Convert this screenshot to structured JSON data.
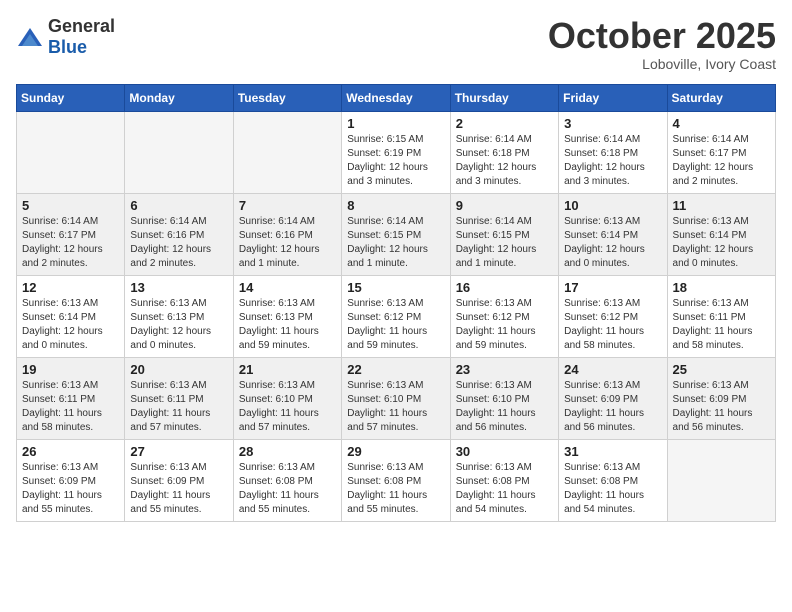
{
  "logo": {
    "general": "General",
    "blue": "Blue"
  },
  "header": {
    "month": "October 2025",
    "location": "Loboville, Ivory Coast"
  },
  "weekdays": [
    "Sunday",
    "Monday",
    "Tuesday",
    "Wednesday",
    "Thursday",
    "Friday",
    "Saturday"
  ],
  "weeks": [
    [
      {
        "day": "",
        "info": ""
      },
      {
        "day": "",
        "info": ""
      },
      {
        "day": "",
        "info": ""
      },
      {
        "day": "1",
        "info": "Sunrise: 6:15 AM\nSunset: 6:19 PM\nDaylight: 12 hours\nand 3 minutes."
      },
      {
        "day": "2",
        "info": "Sunrise: 6:14 AM\nSunset: 6:18 PM\nDaylight: 12 hours\nand 3 minutes."
      },
      {
        "day": "3",
        "info": "Sunrise: 6:14 AM\nSunset: 6:18 PM\nDaylight: 12 hours\nand 3 minutes."
      },
      {
        "day": "4",
        "info": "Sunrise: 6:14 AM\nSunset: 6:17 PM\nDaylight: 12 hours\nand 2 minutes."
      }
    ],
    [
      {
        "day": "5",
        "info": "Sunrise: 6:14 AM\nSunset: 6:17 PM\nDaylight: 12 hours\nand 2 minutes."
      },
      {
        "day": "6",
        "info": "Sunrise: 6:14 AM\nSunset: 6:16 PM\nDaylight: 12 hours\nand 2 minutes."
      },
      {
        "day": "7",
        "info": "Sunrise: 6:14 AM\nSunset: 6:16 PM\nDaylight: 12 hours\nand 1 minute."
      },
      {
        "day": "8",
        "info": "Sunrise: 6:14 AM\nSunset: 6:15 PM\nDaylight: 12 hours\nand 1 minute."
      },
      {
        "day": "9",
        "info": "Sunrise: 6:14 AM\nSunset: 6:15 PM\nDaylight: 12 hours\nand 1 minute."
      },
      {
        "day": "10",
        "info": "Sunrise: 6:13 AM\nSunset: 6:14 PM\nDaylight: 12 hours\nand 0 minutes."
      },
      {
        "day": "11",
        "info": "Sunrise: 6:13 AM\nSunset: 6:14 PM\nDaylight: 12 hours\nand 0 minutes."
      }
    ],
    [
      {
        "day": "12",
        "info": "Sunrise: 6:13 AM\nSunset: 6:14 PM\nDaylight: 12 hours\nand 0 minutes."
      },
      {
        "day": "13",
        "info": "Sunrise: 6:13 AM\nSunset: 6:13 PM\nDaylight: 12 hours\nand 0 minutes."
      },
      {
        "day": "14",
        "info": "Sunrise: 6:13 AM\nSunset: 6:13 PM\nDaylight: 11 hours\nand 59 minutes."
      },
      {
        "day": "15",
        "info": "Sunrise: 6:13 AM\nSunset: 6:12 PM\nDaylight: 11 hours\nand 59 minutes."
      },
      {
        "day": "16",
        "info": "Sunrise: 6:13 AM\nSunset: 6:12 PM\nDaylight: 11 hours\nand 59 minutes."
      },
      {
        "day": "17",
        "info": "Sunrise: 6:13 AM\nSunset: 6:12 PM\nDaylight: 11 hours\nand 58 minutes."
      },
      {
        "day": "18",
        "info": "Sunrise: 6:13 AM\nSunset: 6:11 PM\nDaylight: 11 hours\nand 58 minutes."
      }
    ],
    [
      {
        "day": "19",
        "info": "Sunrise: 6:13 AM\nSunset: 6:11 PM\nDaylight: 11 hours\nand 58 minutes."
      },
      {
        "day": "20",
        "info": "Sunrise: 6:13 AM\nSunset: 6:11 PM\nDaylight: 11 hours\nand 57 minutes."
      },
      {
        "day": "21",
        "info": "Sunrise: 6:13 AM\nSunset: 6:10 PM\nDaylight: 11 hours\nand 57 minutes."
      },
      {
        "day": "22",
        "info": "Sunrise: 6:13 AM\nSunset: 6:10 PM\nDaylight: 11 hours\nand 57 minutes."
      },
      {
        "day": "23",
        "info": "Sunrise: 6:13 AM\nSunset: 6:10 PM\nDaylight: 11 hours\nand 56 minutes."
      },
      {
        "day": "24",
        "info": "Sunrise: 6:13 AM\nSunset: 6:09 PM\nDaylight: 11 hours\nand 56 minutes."
      },
      {
        "day": "25",
        "info": "Sunrise: 6:13 AM\nSunset: 6:09 PM\nDaylight: 11 hours\nand 56 minutes."
      }
    ],
    [
      {
        "day": "26",
        "info": "Sunrise: 6:13 AM\nSunset: 6:09 PM\nDaylight: 11 hours\nand 55 minutes."
      },
      {
        "day": "27",
        "info": "Sunrise: 6:13 AM\nSunset: 6:09 PM\nDaylight: 11 hours\nand 55 minutes."
      },
      {
        "day": "28",
        "info": "Sunrise: 6:13 AM\nSunset: 6:08 PM\nDaylight: 11 hours\nand 55 minutes."
      },
      {
        "day": "29",
        "info": "Sunrise: 6:13 AM\nSunset: 6:08 PM\nDaylight: 11 hours\nand 55 minutes."
      },
      {
        "day": "30",
        "info": "Sunrise: 6:13 AM\nSunset: 6:08 PM\nDaylight: 11 hours\nand 54 minutes."
      },
      {
        "day": "31",
        "info": "Sunrise: 6:13 AM\nSunset: 6:08 PM\nDaylight: 11 hours\nand 54 minutes."
      },
      {
        "day": "",
        "info": ""
      }
    ]
  ]
}
